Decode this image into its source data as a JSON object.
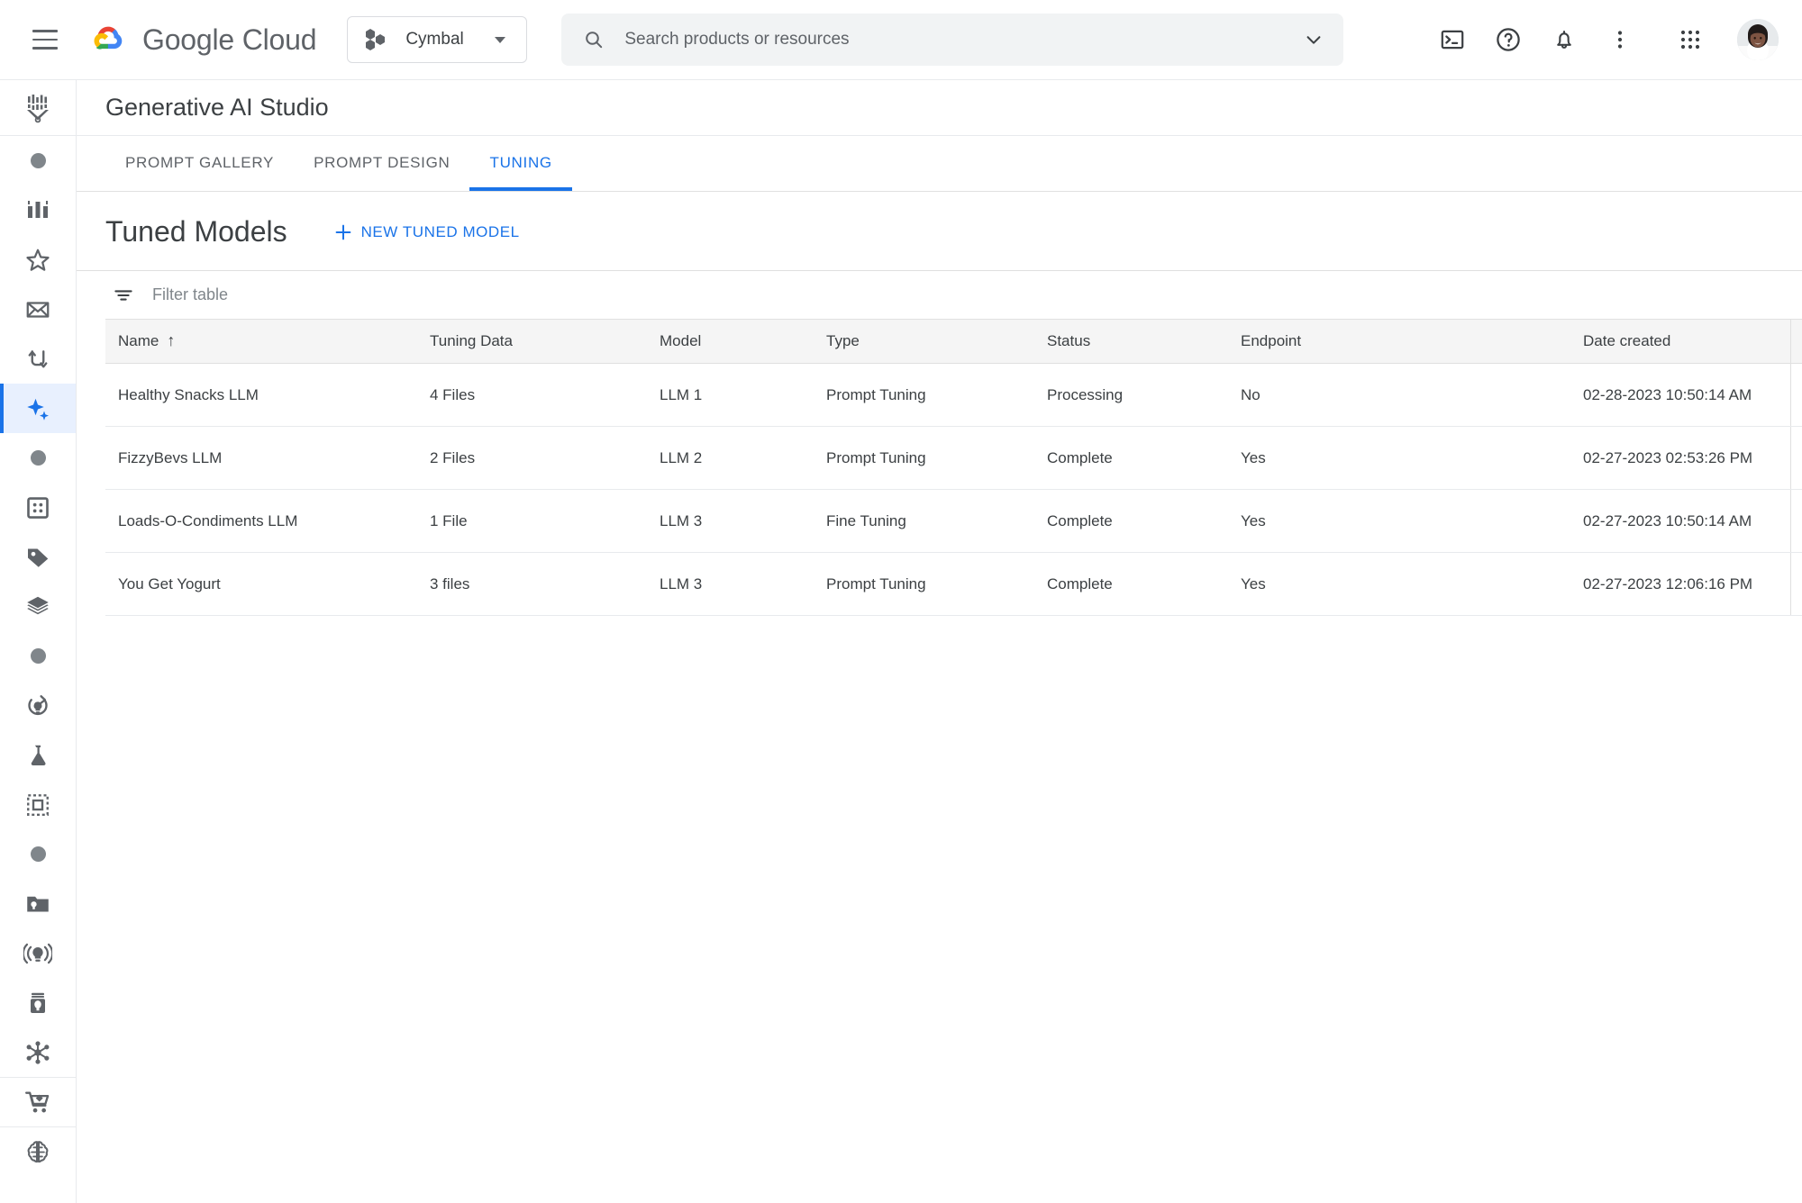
{
  "topbar": {
    "menu_label": "Main menu",
    "brand_google": "Google",
    "brand_cloud": "Cloud",
    "project_name": "Cymbal",
    "search_placeholder": "Search products or resources",
    "search_value": "",
    "icons": {
      "menu": "hamburger-menu-icon",
      "logo": "google-cloud-logo",
      "project": "cymbal-project-icon",
      "project_caret": "chevron-down-icon",
      "search": "search-icon",
      "search_caret": "chevron-down-icon",
      "terminal": "cloud-shell-terminal-icon",
      "help": "help-circle-icon",
      "notifications": "bell-notifications-icon",
      "more": "more-vertical-icon",
      "apps": "apps-grid-icon",
      "avatar": "user-avatar"
    }
  },
  "rail": {
    "header_icon": "vertex-ai-logo-icon",
    "items": [
      {
        "icon": "dot-icon",
        "label": "Section"
      },
      {
        "icon": "dashboard-icon",
        "label": "Dashboard"
      },
      {
        "icon": "star-icon",
        "label": "Featured"
      },
      {
        "icon": "inbox-icon",
        "label": "Inbox"
      },
      {
        "icon": "pipelines-icon",
        "label": "Pipelines"
      },
      {
        "icon": "sparkle-icon",
        "label": "Generative AI Studio"
      },
      {
        "icon": "dot-icon",
        "label": "Section"
      },
      {
        "icon": "datasets-icon",
        "label": "Datasets"
      },
      {
        "icon": "labeling-tag-icon",
        "label": "Labeling"
      },
      {
        "icon": "layers-icon",
        "label": "Feature Store"
      },
      {
        "icon": "dot-icon",
        "label": "Section"
      },
      {
        "icon": "training-refresh-icon",
        "label": "Training"
      },
      {
        "icon": "experiments-flask-icon",
        "label": "Experiments"
      },
      {
        "icon": "metadata-frame-icon",
        "label": "Metadata"
      },
      {
        "icon": "dot-icon",
        "label": "Section"
      },
      {
        "icon": "model-registry-folder-icon",
        "label": "Model Registry"
      },
      {
        "icon": "endpoints-broadcast-icon",
        "label": "Endpoints"
      },
      {
        "icon": "batch-predictions-icon",
        "label": "Batch Predictions"
      },
      {
        "icon": "matching-engine-nodes-icon",
        "label": "Matching Engine"
      },
      {
        "icon": "marketplace-cart-icon",
        "label": "Marketplace"
      },
      {
        "icon": "model-garden-brain-icon",
        "label": "Model Garden"
      }
    ],
    "active_index": 5
  },
  "page": {
    "title": "Generative AI Studio",
    "tabs": [
      {
        "label": "PROMPT GALLERY",
        "active": false
      },
      {
        "label": "PROMPT DESIGN",
        "active": false
      },
      {
        "label": "TUNING",
        "active": true
      }
    ],
    "section_title": "Tuned Models",
    "new_button_label": "NEW TUNED MODEL",
    "filter_placeholder": "Filter table",
    "filter_value": ""
  },
  "table": {
    "sort_column": "Name",
    "sort_direction": "ascending",
    "sort_glyph": "↑",
    "columns": [
      "Name",
      "Tuning Data",
      "Model",
      "Type",
      "Status",
      "Endpoint",
      "Date created"
    ],
    "rows": [
      {
        "name": "Healthy Snacks LLM",
        "tuning_data": "4 Files",
        "model": "LLM 1",
        "type": "Prompt Tuning",
        "status": "Processing",
        "endpoint": "No",
        "date_created": "02-28-2023 10:50:14 AM"
      },
      {
        "name": "FizzyBevs LLM",
        "tuning_data": "2 Files",
        "model": "LLM 2",
        "type": "Prompt Tuning",
        "status": "Complete",
        "endpoint": "Yes",
        "date_created": "02-27-2023 02:53:26 PM"
      },
      {
        "name": "Loads-O-Condiments LLM",
        "tuning_data": "1 File",
        "model": "LLM 3",
        "type": "Fine Tuning",
        "status": "Complete",
        "endpoint": "Yes",
        "date_created": "02-27-2023 10:50:14 AM"
      },
      {
        "name": "You Get Yogurt",
        "tuning_data": "3 files",
        "model": "LLM 3",
        "type": "Prompt Tuning",
        "status": "Complete",
        "endpoint": "Yes",
        "date_created": "02-27-2023 12:06:16 PM"
      }
    ]
  },
  "colors": {
    "accent_blue": "#1a73e8",
    "active_rail_bg": "#e8f0fe",
    "text_primary": "#3c4043",
    "text_secondary": "#5f6368",
    "header_row_bg": "#f5f5f5",
    "search_bg": "#f1f3f4",
    "border": "#e0e0e0"
  }
}
